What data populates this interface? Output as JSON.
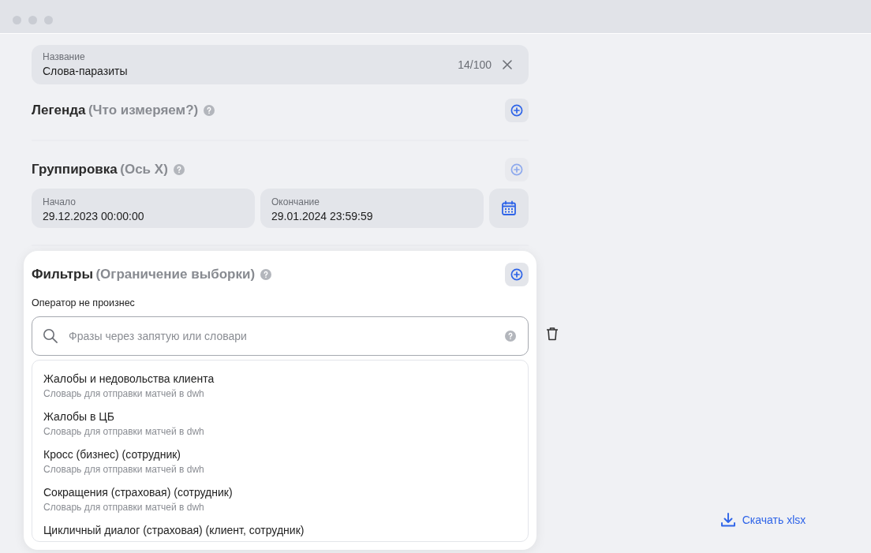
{
  "name_field": {
    "label": "Название",
    "value": "Слова-паразиты",
    "counter": "14/100"
  },
  "legend": {
    "title": "Легенда",
    "subtitle": "(Что измеряем?)",
    "add_disabled": false
  },
  "grouping": {
    "title": "Группировка",
    "subtitle": "(Ось X)",
    "add_disabled": true
  },
  "date_range": [
    {
      "label": "Начало",
      "value": "29.12.2023 00:00:00"
    },
    {
      "label": "Окончание",
      "value": "29.01.2024 23:59:59"
    }
  ],
  "filters": {
    "title": "Фильтры",
    "subtitle": "(Ограничение выборки)",
    "add_disabled": false,
    "operator": "Оператор не произнес",
    "search": {
      "placeholder": "Фразы через запятую или словари"
    },
    "suggestions": [
      {
        "title": "Жалобы и недовольства клиента",
        "subtitle": "Словарь для отправки матчей в dwh"
      },
      {
        "title": "Жалобы в ЦБ",
        "subtitle": "Словарь для отправки матчей в dwh"
      },
      {
        "title": "Кросс (бизнес) (сотрудник)",
        "subtitle": "Словарь для отправки матчей в dwh"
      },
      {
        "title": "Сокращения (страховая) (сотрудник)",
        "subtitle": "Словарь для отправки матчей в dwh"
      },
      {
        "title": "Цикличный диалог (страховая) (клиент, сотрудник)"
      }
    ]
  },
  "download": {
    "label": "Скачать xlsx"
  }
}
